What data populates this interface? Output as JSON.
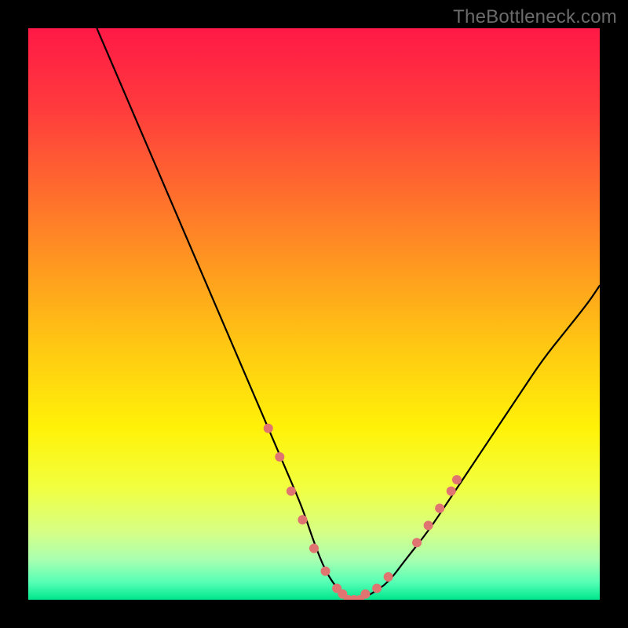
{
  "watermark": "TheBottleneck.com",
  "chart_data": {
    "type": "line",
    "title": "",
    "xlabel": "",
    "ylabel": "",
    "xlim": [
      0,
      100
    ],
    "ylim": [
      0,
      100
    ],
    "background_gradient": {
      "type": "vertical",
      "stops": [
        {
          "pos": 0.0,
          "color": "#ff1946"
        },
        {
          "pos": 0.14,
          "color": "#ff3b3d"
        },
        {
          "pos": 0.28,
          "color": "#ff6a2e"
        },
        {
          "pos": 0.42,
          "color": "#ff9a1f"
        },
        {
          "pos": 0.56,
          "color": "#ffc912"
        },
        {
          "pos": 0.7,
          "color": "#fff208"
        },
        {
          "pos": 0.8,
          "color": "#f2ff3d"
        },
        {
          "pos": 0.88,
          "color": "#d7ff84"
        },
        {
          "pos": 0.93,
          "color": "#a9ffb0"
        },
        {
          "pos": 0.97,
          "color": "#54ffb5"
        },
        {
          "pos": 1.0,
          "color": "#00e68c"
        }
      ]
    },
    "series": [
      {
        "name": "bottleneck-curve",
        "color": "#000000",
        "x": [
          12,
          15,
          18,
          21,
          24,
          27,
          30,
          33,
          36,
          39,
          42,
          45,
          48,
          50,
          52,
          54,
          56,
          58,
          60,
          63,
          66,
          70,
          74,
          78,
          82,
          86,
          90,
          94,
          98,
          100
        ],
        "y": [
          100,
          93,
          86,
          79,
          72,
          65,
          58,
          51,
          44,
          37,
          30,
          23,
          16,
          10,
          5,
          2,
          0,
          0,
          1,
          3,
          7,
          12,
          18,
          24,
          30,
          36,
          42,
          47,
          52,
          55
        ]
      }
    ],
    "markers": {
      "name": "highlight-dots",
      "color": "#e07470",
      "radius": 6,
      "points": [
        {
          "x": 42,
          "y": 30
        },
        {
          "x": 44,
          "y": 25
        },
        {
          "x": 46,
          "y": 19
        },
        {
          "x": 48,
          "y": 14
        },
        {
          "x": 50,
          "y": 9
        },
        {
          "x": 52,
          "y": 5
        },
        {
          "x": 54,
          "y": 2
        },
        {
          "x": 55,
          "y": 1
        },
        {
          "x": 56,
          "y": 0
        },
        {
          "x": 57,
          "y": 0
        },
        {
          "x": 58,
          "y": 0
        },
        {
          "x": 59,
          "y": 1
        },
        {
          "x": 61,
          "y": 2
        },
        {
          "x": 63,
          "y": 4
        },
        {
          "x": 68,
          "y": 10
        },
        {
          "x": 70,
          "y": 13
        },
        {
          "x": 72,
          "y": 16
        },
        {
          "x": 74,
          "y": 19
        },
        {
          "x": 75,
          "y": 21
        }
      ]
    }
  }
}
